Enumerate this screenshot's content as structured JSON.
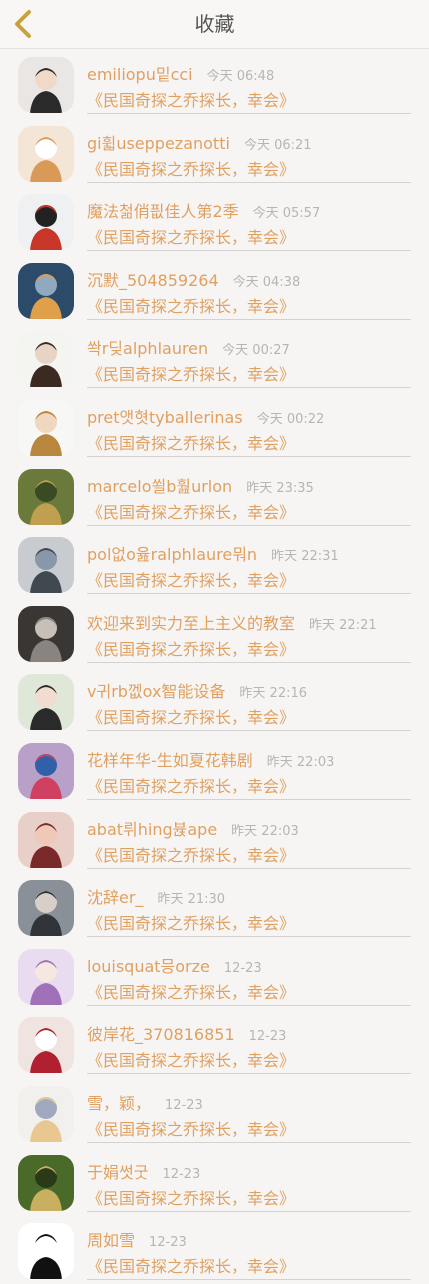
{
  "header": {
    "title": "收藏",
    "back_icon": "chevron-left-icon",
    "accent": "#c9a23a"
  },
  "items": [
    {
      "name": "emiliopu밑cci",
      "time": "今天 06:48",
      "subtitle": "《民国奇探之乔探长，幸会》"
    },
    {
      "name": "gi휣useppezanotti",
      "time": "今天 06:21",
      "subtitle": "《民国奇探之乔探长，幸会》"
    },
    {
      "name": "魔法첢俏픲佳人第2季",
      "time": "今天 05:57",
      "subtitle": "《民国奇探之乔探长，幸会》"
    },
    {
      "name": "沉默_504859264",
      "time": "今天 04:38",
      "subtitle": "《民国奇探之乔探长，幸会》"
    },
    {
      "name": "쏵r딪alphlauren",
      "time": "今天 00:27",
      "subtitle": "《民国奇探之乔探长，幸会》"
    },
    {
      "name": "pret앳혓tyballerinas",
      "time": "今天 00:22",
      "subtitle": "《民国奇探之乔探长，幸会》"
    },
    {
      "name": "marcelo쐴b훮urlon",
      "time": "昨天 23:35",
      "subtitle": "《民国奇探之乔探长，幸会》"
    },
    {
      "name": "pol없o윮ralphlaure뭐n",
      "time": "昨天 22:31",
      "subtitle": "《民国奇探之乔探长，幸会》"
    },
    {
      "name": "欢迎来到实力至上主义的教室",
      "time": "昨天 22:21",
      "subtitle": "《民国奇探之乔探长，幸会》"
    },
    {
      "name": "v귀rb껪ox智能设备",
      "time": "昨天 22:16",
      "subtitle": "《民国奇探之乔探长，幸会》"
    },
    {
      "name": "花样年华-生如夏花韩剧",
      "time": "昨天 22:03",
      "subtitle": "《民国奇探之乔探长，幸会》"
    },
    {
      "name": "abat뤼hing뷵ape",
      "time": "昨天 22:03",
      "subtitle": "《民国奇探之乔探长，幸会》"
    },
    {
      "name": "沈辞er_",
      "time": "昨天 21:30",
      "subtitle": "《民国奇探之乔探长，幸会》"
    },
    {
      "name": "louisquat믕orze",
      "time": "12-23",
      "subtitle": "《民国奇探之乔探长，幸会》"
    },
    {
      "name": "彼岸花_370816851",
      "time": "12-23",
      "subtitle": "《民国奇探之乔探长，幸会》"
    },
    {
      "name": "雪，颖，",
      "time": "12-23",
      "subtitle": "《民国奇探之乔探长，幸会》"
    },
    {
      "name": "于娟썻굿",
      "time": "12-23",
      "subtitle": "《民国奇探之乔探长，幸会》"
    },
    {
      "name": "周如雪",
      "time": "12-23",
      "subtitle": "《民国奇探之乔探长，幸会》"
    }
  ]
}
